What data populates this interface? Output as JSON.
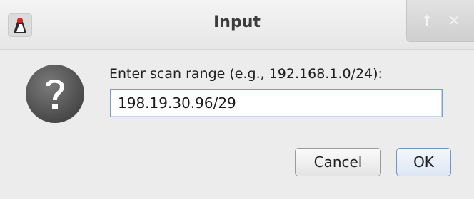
{
  "window": {
    "title": "Input",
    "controls": {
      "up_icon": "up-arrow-icon",
      "close_icon": "close-icon",
      "up_glyph": "↑",
      "close_glyph": "✕"
    },
    "app_icon": "java-duke-icon"
  },
  "dialog": {
    "icon": "question-icon",
    "prompt": "Enter scan range (e.g., 192.168.1.0/24):",
    "input_value": "198.19.30.96/29",
    "buttons": {
      "cancel_label": "Cancel",
      "ok_label": "OK"
    }
  },
  "colors": {
    "accent_border": "#7a9ccc",
    "question_icon": "#5e5e5e"
  }
}
